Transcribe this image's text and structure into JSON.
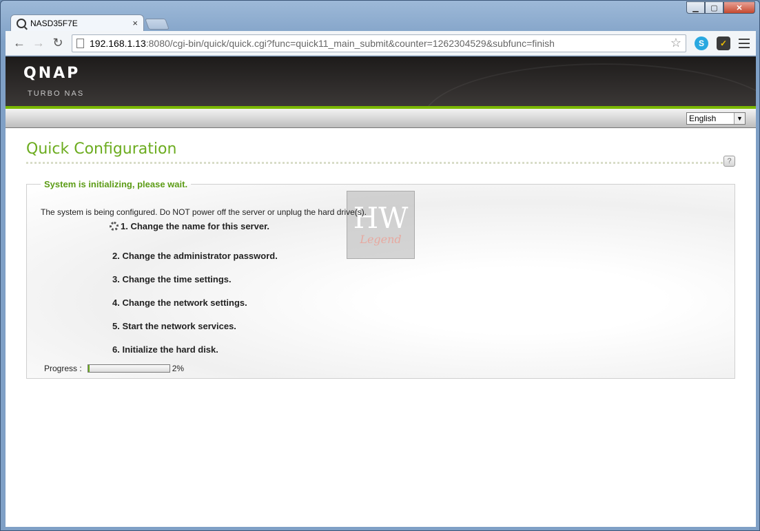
{
  "browser": {
    "tab_title": "NASD35F7E",
    "tab_close": "×",
    "url_host": "192.168.1.13",
    "url_rest": ":8080/cgi-bin/quick/quick.cgi?func=quick11_main_submit&counter=1262304529&subfunc=finish"
  },
  "header": {
    "logo": "QNAP",
    "subtitle": "TURBO NAS",
    "language": "English"
  },
  "main": {
    "title": "Quick Configuration",
    "help": "?",
    "legend": "System is initializing, please wait.",
    "message": "The system is being configured. Do NOT power off the server or unplug the hard drive(s).",
    "steps": [
      "1. Change the name for this server.",
      "2. Change the administrator password.",
      "3. Change the time settings.",
      "4. Change the network settings.",
      "5. Start the network services.",
      "6. Initialize the hard disk."
    ],
    "progress_label": "Progress :",
    "progress_value": 2,
    "progress_text": "2%"
  },
  "watermark": {
    "main": "HW",
    "sub": "Legend"
  },
  "colors": {
    "accent_green": "#6cac1f",
    "header_dark": "#2f2c2b"
  }
}
